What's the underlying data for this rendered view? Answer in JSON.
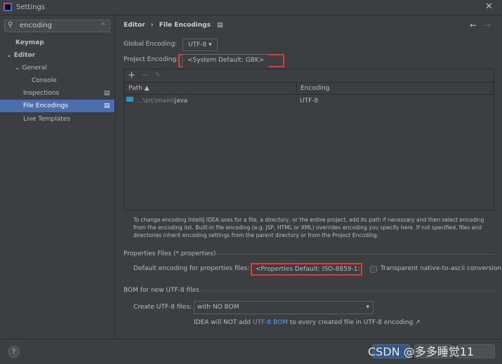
{
  "window": {
    "title": "Settings"
  },
  "search": {
    "value": "encoding"
  },
  "sidebar": {
    "items": [
      {
        "label": "Keymap"
      },
      {
        "label": "Editor"
      },
      {
        "label": "General"
      },
      {
        "label": "Console"
      },
      {
        "label": "Inspections"
      },
      {
        "label": "File Encodings"
      },
      {
        "label": "Live Templates"
      }
    ]
  },
  "breadcrumb": {
    "parent": "Editor",
    "sep": "›",
    "current": "File Encodings"
  },
  "global": {
    "label": "Global Encoding:",
    "value": "UTF-8"
  },
  "project": {
    "label": "Project Encoding:",
    "value": "<System Default: GBK>"
  },
  "table": {
    "headers": [
      "Path",
      "Encoding"
    ],
    "rows": [
      {
        "path_prefix": "...\\src\\main\\",
        "path_name": "java",
        "encoding": "UTF-8"
      }
    ]
  },
  "info": "To change encoding IntelliJ IDEA uses for a file, a directory, or the entire project, add its path if necessary and then select encoding from the encoding list. Built-in file encoding (e.g. JSP, HTML or XML) overrides encoding you specify here. If not specified, files and directories inherit encoding settings from the parent directory or from the Project Encoding.",
  "properties": {
    "section": "Properties Files (*.properties)",
    "label": "Default encoding for properties files:",
    "value": "<Properties Default: ISO-8859-1>",
    "checkbox_label": "Transparent native-to-ascii conversion",
    "checked": false
  },
  "bom": {
    "section": "BOM for new UTF-8 files",
    "label": "Create UTF-8 files:",
    "value": "with NO BOM",
    "note_pre": "IDEA will NOT add ",
    "note_link": "UTF-8 BOM",
    "note_post": " to every created file in UTF-8 encoding ↗"
  },
  "watermark": "CSDN @多多睡觉11",
  "colors": {
    "accent": "#4b6eaf",
    "link": "#589df6",
    "highlight": "#e53935"
  }
}
